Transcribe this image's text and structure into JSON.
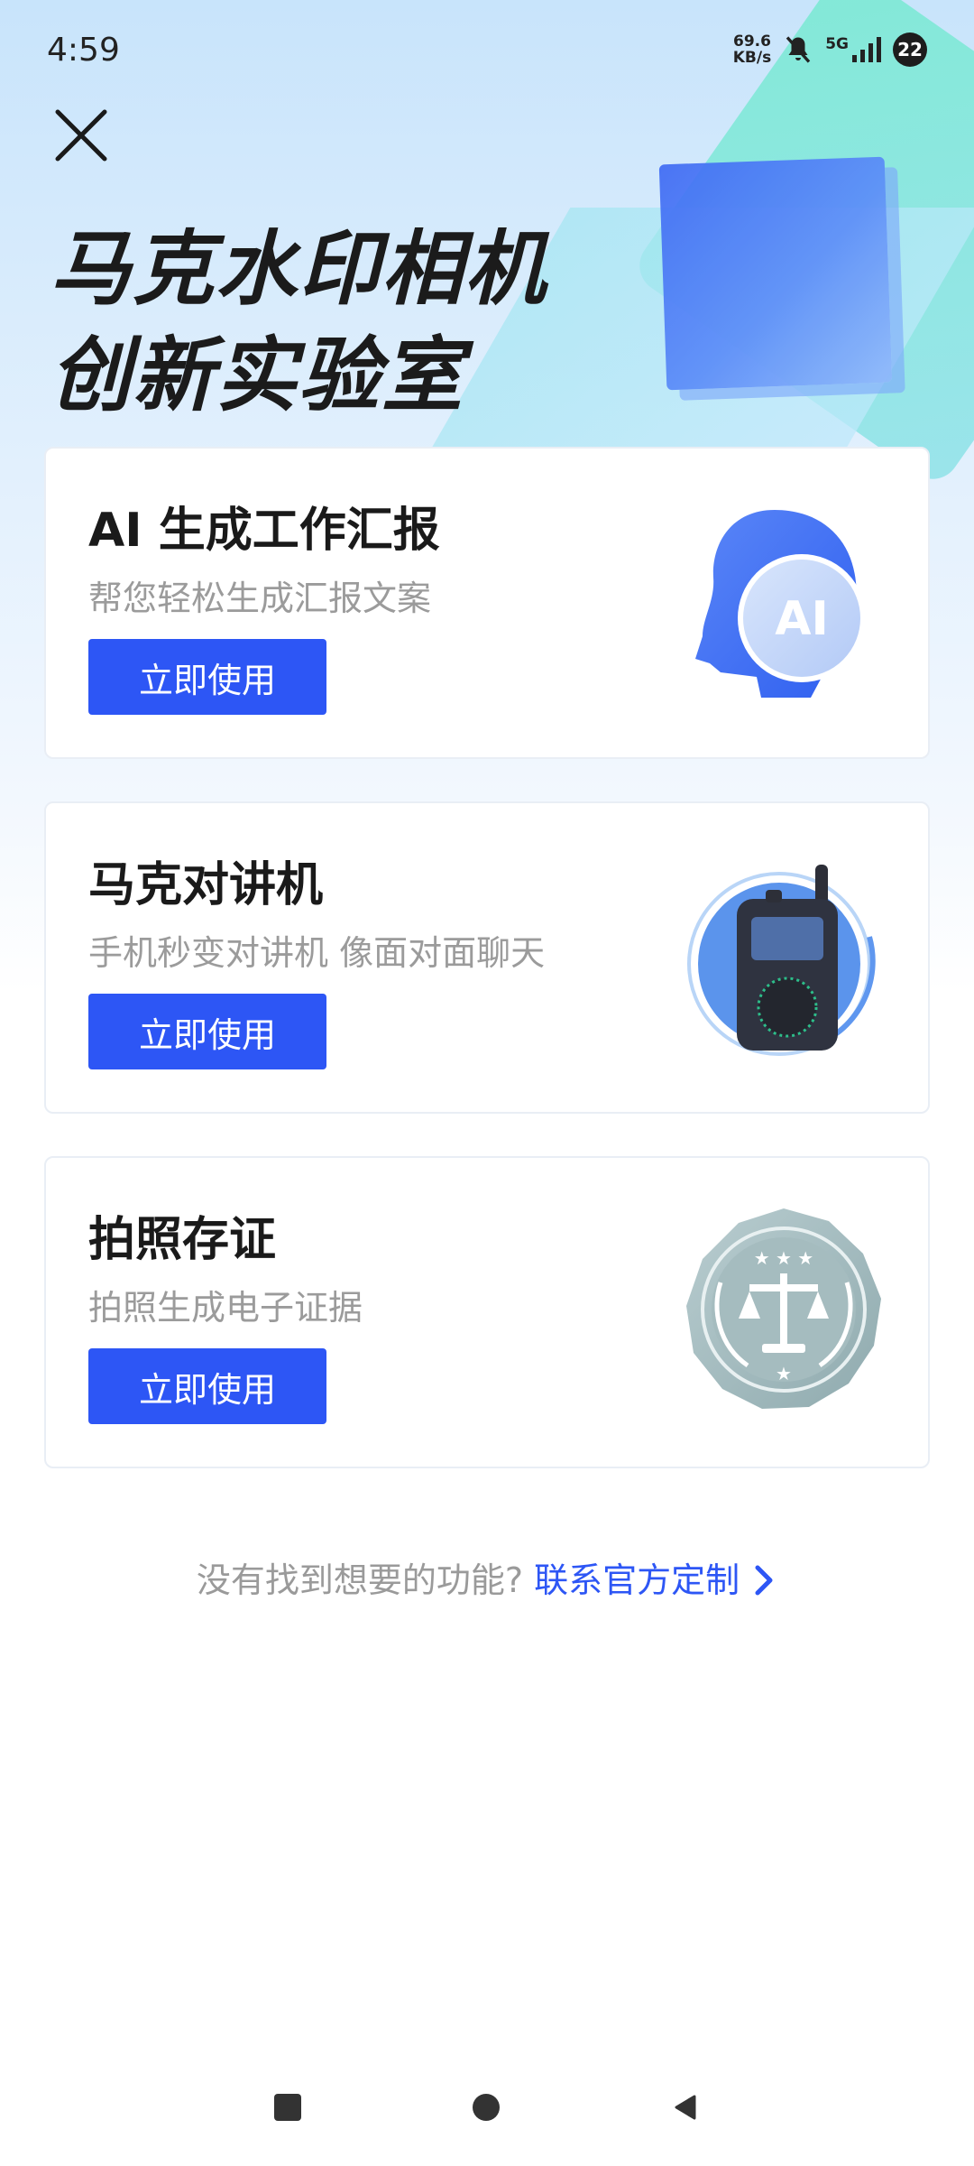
{
  "status": {
    "time": "4:59",
    "speed_value": "69.6",
    "speed_unit": "KB/s",
    "network": "5G",
    "notification_count": "22"
  },
  "hero": {
    "title_line1": "马克水印相机",
    "title_line2": "创新实验室"
  },
  "cards": [
    {
      "title": "AI 生成工作汇报",
      "subtitle": "帮您轻松生成汇报文案",
      "button": "立即使用",
      "icon": "ai-head-icon",
      "icon_text": "AI"
    },
    {
      "title": "马克对讲机",
      "subtitle": "手机秒变对讲机 像面对面聊天",
      "button": "立即使用",
      "icon": "walkie-talkie-icon"
    },
    {
      "title": "拍照存证",
      "subtitle": "拍照生成电子证据",
      "button": "立即使用",
      "icon": "justice-seal-icon"
    }
  ],
  "footer": {
    "prompt": "没有找到想要的功能?",
    "link": "联系官方定制"
  },
  "colors": {
    "accent": "#2d56f5",
    "title": "#1a1a1a",
    "subtitle": "#9b9b9b"
  }
}
